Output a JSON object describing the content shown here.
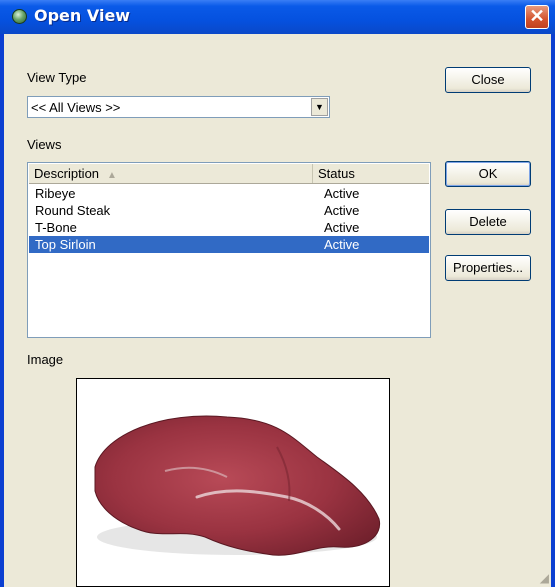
{
  "window": {
    "title": "Open View"
  },
  "view_type": {
    "label": "View Type",
    "selected": "<< All Views >>"
  },
  "views": {
    "label": "Views",
    "columns": [
      "Description",
      "Status"
    ],
    "rows": [
      {
        "description": "Ribeye",
        "status": "Active"
      },
      {
        "description": "Round Steak",
        "status": "Active"
      },
      {
        "description": "T-Bone",
        "status": "Active"
      },
      {
        "description": "Top Sirloin",
        "status": "Active"
      }
    ],
    "selected_index": 3
  },
  "buttons": {
    "close": "Close",
    "ok": "OK",
    "delete": "Delete",
    "properties": "Properties..."
  },
  "image": {
    "label": "Image"
  },
  "colors": {
    "titlebar": "#0551df",
    "selection": "#316ac5",
    "face": "#ece9d8"
  }
}
